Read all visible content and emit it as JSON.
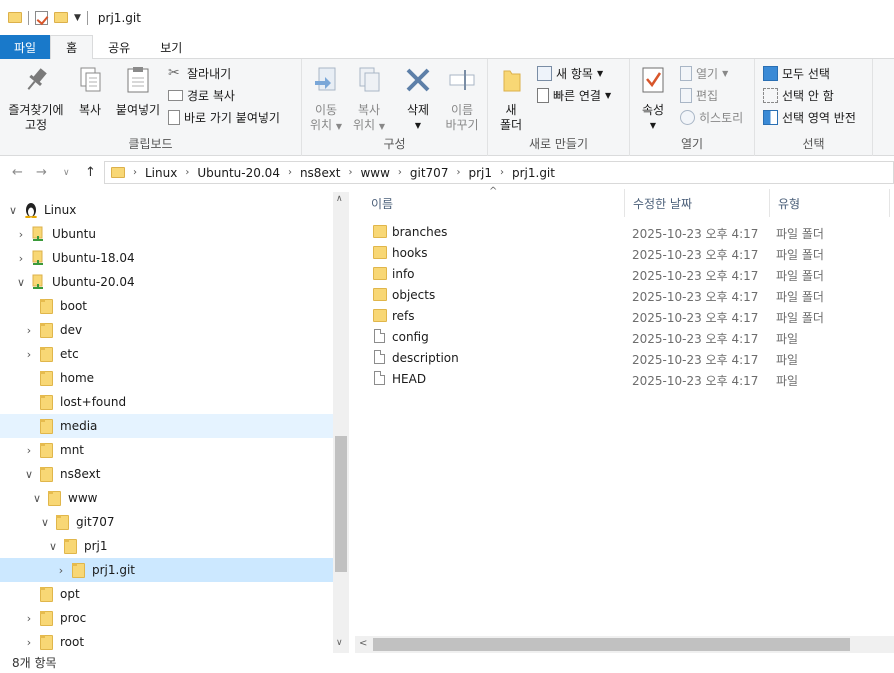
{
  "window": {
    "title": "prj1.git"
  },
  "tabs": [
    "파일",
    "홈",
    "공유",
    "보기"
  ],
  "ribbon": {
    "clipboard": {
      "pin_label_1": "즐겨찾기에",
      "pin_label_2": "고정",
      "copy": "복사",
      "paste": "붙여넣기",
      "cut": "잘라내기",
      "copy_path": "경로 복사",
      "paste_shortcut": "바로 가기 붙여넣기",
      "label": "클립보드"
    },
    "organize": {
      "move_1": "이동",
      "move_2": "위치",
      "copy_1": "복사",
      "copy_2": "위치",
      "delete": "삭제",
      "rename_1": "이름",
      "rename_2": "바꾸기",
      "label": "구성"
    },
    "new": {
      "folder_1": "새",
      "folder_2": "폴더",
      "new_item": "새 항목",
      "easy_access": "빠른 연결",
      "label": "새로 만들기"
    },
    "open": {
      "properties": "속성",
      "open": "열기",
      "edit": "편집",
      "history": "히스토리",
      "label": "열기"
    },
    "select": {
      "select_all": "모두 선택",
      "select_none": "선택 안 함",
      "invert": "선택 영역 반전",
      "label": "선택"
    }
  },
  "breadcrumb": [
    "Linux",
    "Ubuntu-20.04",
    "ns8ext",
    "www",
    "git707",
    "prj1",
    "prj1.git"
  ],
  "tree": [
    {
      "label": "Linux",
      "chevron": "open",
      "icon": "linux-penguin-icon"
    },
    {
      "label": "Ubuntu",
      "chevron": "closed",
      "icon": "distro-icon"
    },
    {
      "label": "Ubuntu-18.04",
      "chevron": "closed",
      "icon": "distro-icon"
    },
    {
      "label": "Ubuntu-20.04",
      "chevron": "open",
      "icon": "distro-icon"
    },
    {
      "label": "boot",
      "chevron": "none",
      "icon": "folder-icon"
    },
    {
      "label": "dev",
      "chevron": "closed",
      "icon": "folder-icon"
    },
    {
      "label": "etc",
      "chevron": "closed",
      "icon": "folder-icon"
    },
    {
      "label": "home",
      "chevron": "none",
      "icon": "folder-icon"
    },
    {
      "label": "lost+found",
      "chevron": "none",
      "icon": "folder-icon"
    },
    {
      "label": "media",
      "chevron": "none",
      "icon": "folder-icon",
      "state": "hover"
    },
    {
      "label": "mnt",
      "chevron": "closed",
      "icon": "folder-icon"
    },
    {
      "label": "ns8ext",
      "chevron": "open",
      "icon": "folder-icon"
    },
    {
      "label": "www",
      "chevron": "open",
      "icon": "folder-icon"
    },
    {
      "label": "git707",
      "chevron": "open",
      "icon": "folder-icon"
    },
    {
      "label": "prj1",
      "chevron": "open",
      "icon": "folder-icon"
    },
    {
      "label": "prj1.git",
      "chevron": "closed",
      "icon": "folder-icon",
      "state": "selected"
    },
    {
      "label": "opt",
      "chevron": "none",
      "icon": "folder-icon"
    },
    {
      "label": "proc",
      "chevron": "closed",
      "icon": "folder-icon"
    },
    {
      "label": "root",
      "chevron": "closed",
      "icon": "folder-icon"
    }
  ],
  "columns": {
    "name": "이름",
    "modified": "수정한 날짜",
    "type": "유형"
  },
  "files": [
    {
      "name": "branches",
      "modified": "2025-10-23 오후 4:17",
      "type": "파일 폴더",
      "kind": "folder"
    },
    {
      "name": "hooks",
      "modified": "2025-10-23 오후 4:17",
      "type": "파일 폴더",
      "kind": "folder"
    },
    {
      "name": "info",
      "modified": "2025-10-23 오후 4:17",
      "type": "파일 폴더",
      "kind": "folder"
    },
    {
      "name": "objects",
      "modified": "2025-10-23 오후 4:17",
      "type": "파일 폴더",
      "kind": "folder"
    },
    {
      "name": "refs",
      "modified": "2025-10-23 오후 4:17",
      "type": "파일 폴더",
      "kind": "folder"
    },
    {
      "name": "config",
      "modified": "2025-10-23 오후 4:17",
      "type": "파일",
      "kind": "file"
    },
    {
      "name": "description",
      "modified": "2025-10-23 오후 4:17",
      "type": "파일",
      "kind": "file"
    },
    {
      "name": "HEAD",
      "modified": "2025-10-23 오후 4:17",
      "type": "파일",
      "kind": "file"
    }
  ],
  "status": {
    "count": "8개 항목"
  }
}
